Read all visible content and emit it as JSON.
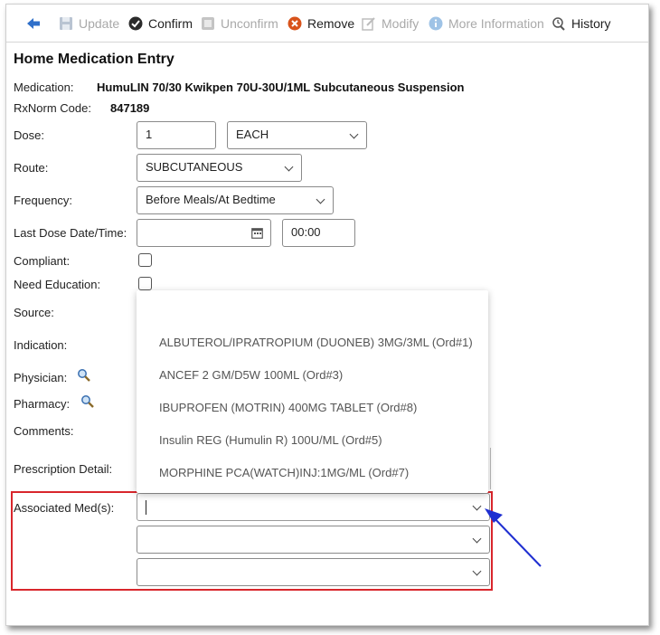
{
  "toolbar": {
    "back_label": "",
    "update_label": "Update",
    "confirm_label": "Confirm",
    "unconfirm_label": "Unconfirm",
    "remove_label": "Remove",
    "modify_label": "Modify",
    "more_info_label": "More Information",
    "history_label": "History"
  },
  "form": {
    "title": "Home Medication Entry",
    "medication_label": "Medication:",
    "medication_value": "HumuLIN 70/30 Kwikpen 70U-30U/1ML Subcutaneous Suspension",
    "rxnorm_label": "RxNorm Code:",
    "rxnorm_value": "847189",
    "dose_label": "Dose:",
    "dose_value": "1",
    "dose_unit": "EACH",
    "route_label": "Route:",
    "route_value": "SUBCUTANEOUS",
    "frequency_label": "Frequency:",
    "frequency_value": "Before Meals/At Bedtime",
    "last_dose_label": "Last Dose Date/Time:",
    "last_dose_date": "",
    "last_dose_time": "00:00",
    "compliant_label": "Compliant:",
    "need_education_label": "Need Education:",
    "source_label": "Source:",
    "indication_label": "Indication:",
    "physician_label": "Physician:",
    "pharmacy_label": "Pharmacy:",
    "comments_label": "Comments:",
    "prescription_detail_label": "Prescription Detail:",
    "associated_meds_label": "Associated Med(s):"
  },
  "dropdown": {
    "options": [
      "ALBUTEROL/IPRATROPIUM (DUONEB) 3MG/3ML (Ord#1)",
      "ANCEF 2 GM/D5W 100ML (Ord#3)",
      "IBUPROFEN (MOTRIN) 400MG TABLET (Ord#8)",
      "Insulin REG (Humulin R) 100U/ML (Ord#5)",
      "MORPHINE PCA(WATCH)INJ:1MG/ML (Ord#7)"
    ]
  },
  "colors": {
    "highlight": "#d9262c",
    "arrow": "#1f2fd1",
    "back_arrow": "#2f6fc9"
  },
  "icons": [
    "back-arrow-icon",
    "save-icon",
    "check-circle-icon",
    "unconfirm-icon",
    "remove-icon",
    "modify-icon",
    "info-icon",
    "history-icon",
    "calendar-icon",
    "magnifier-icon"
  ]
}
